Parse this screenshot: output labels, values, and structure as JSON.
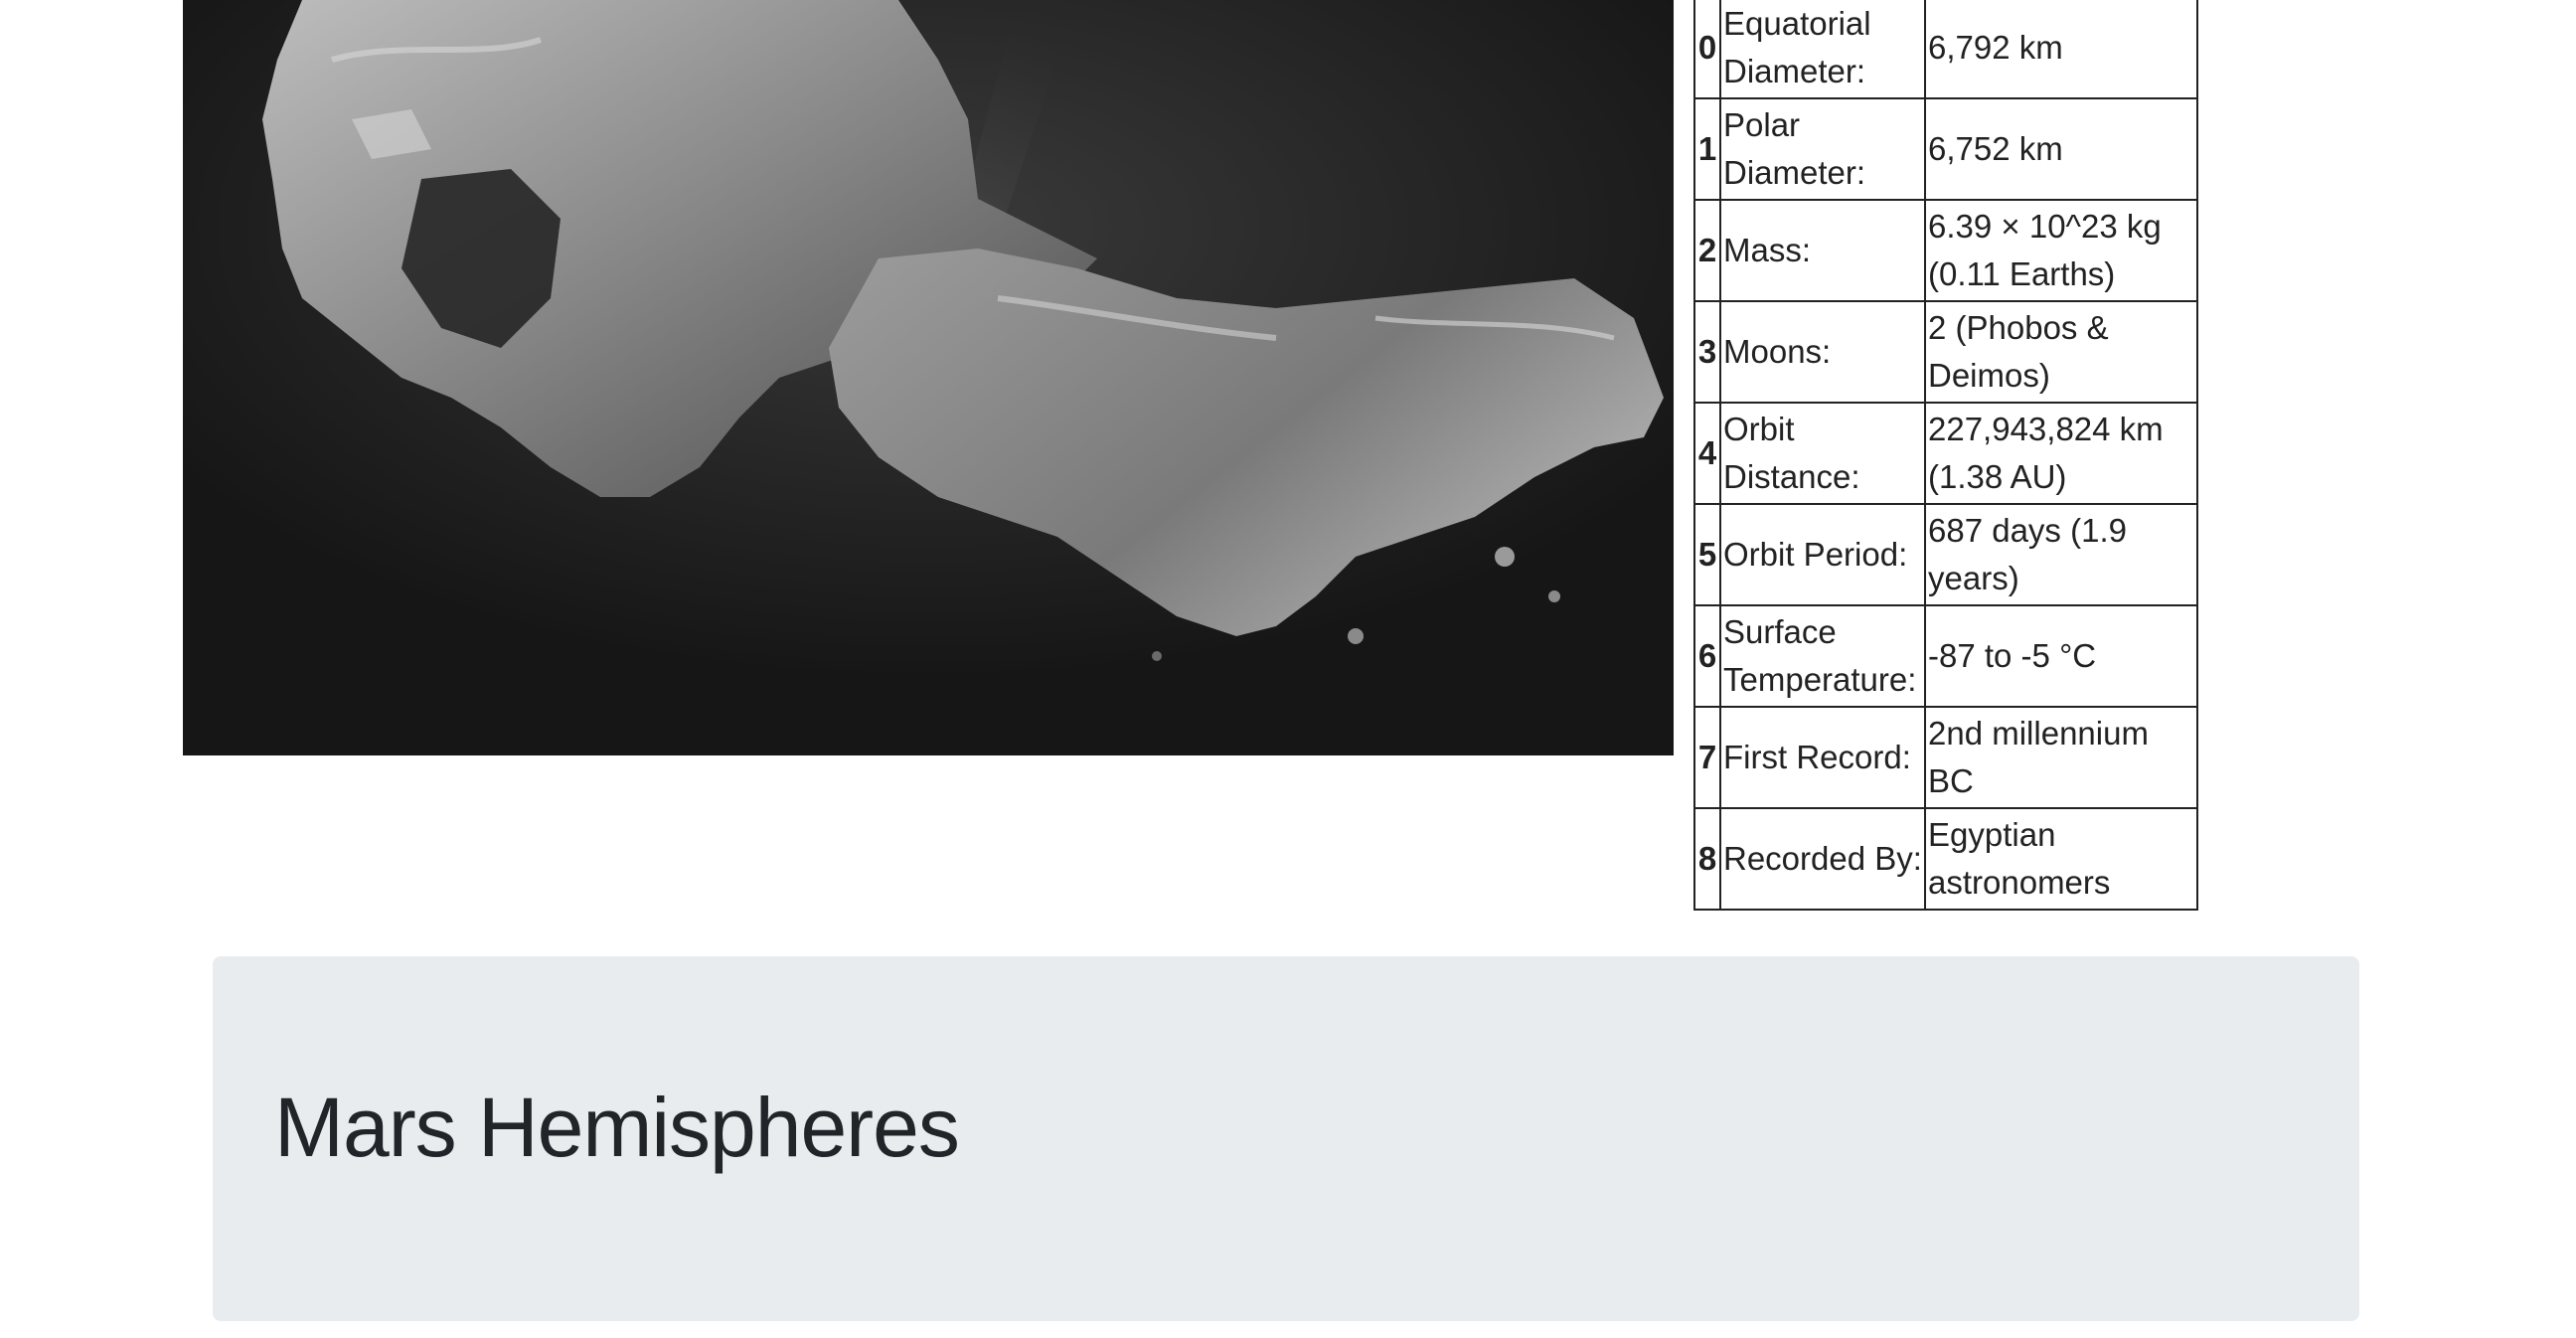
{
  "featured_image": {
    "alt": "Comet surface photograph",
    "icon": "comet-photo"
  },
  "facts": {
    "rows": [
      {
        "index": "0",
        "label": "Equatorial Diameter:",
        "value": "6,792 km"
      },
      {
        "index": "1",
        "label": "Polar Diameter:",
        "value": "6,752 km"
      },
      {
        "index": "2",
        "label": "Mass:",
        "value": "6.39 × 10^23 kg (0.11 Earths)"
      },
      {
        "index": "3",
        "label": "Moons:",
        "value": "2 (Phobos & Deimos)"
      },
      {
        "index": "4",
        "label": "Orbit Distance:",
        "value": "227,943,824 km (1.38 AU)"
      },
      {
        "index": "5",
        "label": "Orbit Period:",
        "value": "687 days (1.9 years)"
      },
      {
        "index": "6",
        "label": "Surface Temperature:",
        "value": "-87 to -5 °C"
      },
      {
        "index": "7",
        "label": "First Record:",
        "value": "2nd millennium BC"
      },
      {
        "index": "8",
        "label": "Recorded By:",
        "value": "Egyptian astronomers"
      }
    ]
  },
  "hemispheres": {
    "title": "Mars Hemispheres"
  },
  "colors": {
    "jumbotron_bg": "#e9ecef",
    "text": "#212529",
    "table_border": "#222222"
  }
}
